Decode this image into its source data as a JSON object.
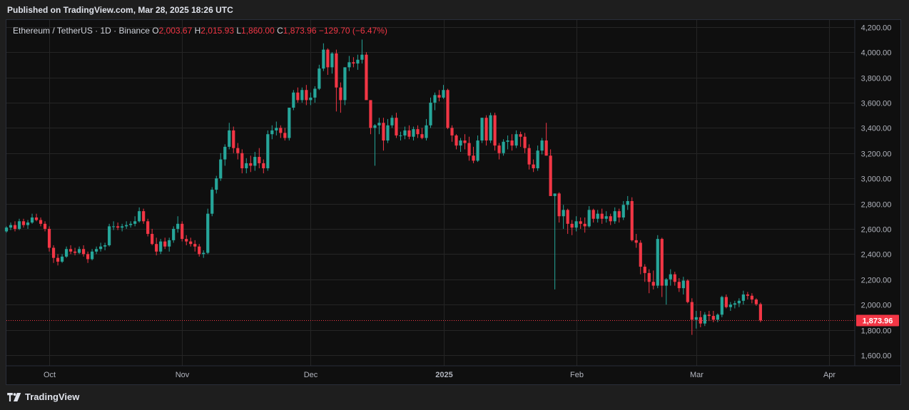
{
  "header": {
    "published": "Published on TradingView.com, Mar 28, 2025 18:26 UTC"
  },
  "legend": {
    "symbol": "Ethereum / TetherUS · 1D · Binance",
    "o_label": "O",
    "o_value": "2,003.67",
    "h_label": "H",
    "h_value": "2,015.93",
    "l_label": "L",
    "l_value": "1,860.00",
    "c_label": "C",
    "c_value": "1,873.96",
    "change": "−129.70 (−6.47%)"
  },
  "footer": {
    "brand": "TradingView",
    "logo_icon": "tradingview-logo-icon"
  },
  "colors": {
    "up": "#26a69a",
    "down": "#f23645",
    "grid": "#252525",
    "price_label_bg": "#f23645",
    "background": "#0f0f0f"
  },
  "chart_data": {
    "type": "candlestick",
    "symbol": "ETHUSDT",
    "interval": "1D",
    "x_axis_type": "date",
    "x_ticks": [
      {
        "label": "Oct",
        "date": "2024-10-01",
        "bold": false
      },
      {
        "label": "Nov",
        "date": "2024-11-01",
        "bold": false
      },
      {
        "label": "Dec",
        "date": "2024-12-01",
        "bold": false
      },
      {
        "label": "2025",
        "date": "2025-01-01",
        "bold": true
      },
      {
        "label": "Feb",
        "date": "2025-02-01",
        "bold": false
      },
      {
        "label": "Mar",
        "date": "2025-03-01",
        "bold": false
      },
      {
        "label": "Apr",
        "date": "2025-04-01",
        "bold": false
      }
    ],
    "x_range": [
      "2024-09-21",
      "2025-04-07"
    ],
    "y_ticks": [
      {
        "value": 1600,
        "label": "1,600.00"
      },
      {
        "value": 1800,
        "label": "1,800.00"
      },
      {
        "value": 2000,
        "label": "2,000.00"
      },
      {
        "value": 2200,
        "label": "2,200.00"
      },
      {
        "value": 2400,
        "label": "2,400.00"
      },
      {
        "value": 2600,
        "label": "2,600.00"
      },
      {
        "value": 2800,
        "label": "2,800.00"
      },
      {
        "value": 3000,
        "label": "3,000.00"
      },
      {
        "value": 3200,
        "label": "3,200.00"
      },
      {
        "value": 3400,
        "label": "3,400.00"
      },
      {
        "value": 3600,
        "label": "3,600.00"
      },
      {
        "value": 3800,
        "label": "3,800.00"
      },
      {
        "value": 4000,
        "label": "4,000.00"
      },
      {
        "value": 4200,
        "label": "4,200.00"
      }
    ],
    "ylim": [
      1515,
      4255
    ],
    "last_price": {
      "value": 1873.96,
      "label": "1,873.96"
    },
    "grid": true,
    "start_date": "2024-09-21",
    "candles": [
      [
        2580,
        2620,
        2570,
        2610
      ],
      [
        2610,
        2650,
        2590,
        2630
      ],
      [
        2630,
        2660,
        2580,
        2600
      ],
      [
        2600,
        2680,
        2590,
        2660
      ],
      [
        2660,
        2680,
        2610,
        2630
      ],
      [
        2630,
        2670,
        2600,
        2650
      ],
      [
        2650,
        2720,
        2640,
        2690
      ],
      [
        2690,
        2720,
        2660,
        2670
      ],
      [
        2670,
        2690,
        2620,
        2640
      ],
      [
        2640,
        2660,
        2580,
        2600
      ],
      [
        2600,
        2620,
        2420,
        2450
      ],
      [
        2450,
        2470,
        2330,
        2370
      ],
      [
        2370,
        2400,
        2310,
        2340
      ],
      [
        2340,
        2400,
        2330,
        2380
      ],
      [
        2380,
        2460,
        2370,
        2440
      ],
      [
        2440,
        2470,
        2400,
        2420
      ],
      [
        2420,
        2450,
        2390,
        2410
      ],
      [
        2410,
        2460,
        2400,
        2440
      ],
      [
        2440,
        2470,
        2380,
        2400
      ],
      [
        2400,
        2420,
        2330,
        2360
      ],
      [
        2360,
        2440,
        2350,
        2420
      ],
      [
        2420,
        2460,
        2400,
        2440
      ],
      [
        2440,
        2490,
        2420,
        2460
      ],
      [
        2460,
        2490,
        2430,
        2470
      ],
      [
        2470,
        2640,
        2460,
        2620
      ],
      [
        2620,
        2660,
        2590,
        2620
      ],
      [
        2620,
        2650,
        2590,
        2610
      ],
      [
        2610,
        2640,
        2580,
        2620
      ],
      [
        2620,
        2660,
        2600,
        2630
      ],
      [
        2630,
        2660,
        2610,
        2640
      ],
      [
        2640,
        2700,
        2620,
        2660
      ],
      [
        2660,
        2770,
        2650,
        2740
      ],
      [
        2740,
        2760,
        2640,
        2660
      ],
      [
        2660,
        2680,
        2540,
        2560
      ],
      [
        2560,
        2600,
        2470,
        2480
      ],
      [
        2480,
        2530,
        2390,
        2420
      ],
      [
        2420,
        2520,
        2400,
        2500
      ],
      [
        2500,
        2530,
        2440,
        2460
      ],
      [
        2460,
        2530,
        2420,
        2510
      ],
      [
        2510,
        2620,
        2490,
        2600
      ],
      [
        2600,
        2700,
        2570,
        2640
      ],
      [
        2640,
        2660,
        2500,
        2520
      ],
      [
        2520,
        2550,
        2470,
        2500
      ],
      [
        2500,
        2530,
        2460,
        2480
      ],
      [
        2480,
        2510,
        2420,
        2460
      ],
      [
        2460,
        2480,
        2380,
        2400
      ],
      [
        2400,
        2430,
        2370,
        2410
      ],
      [
        2410,
        2760,
        2400,
        2720
      ],
      [
        2720,
        2930,
        2700,
        2910
      ],
      [
        2910,
        3020,
        2880,
        3000
      ],
      [
        3000,
        3200,
        2980,
        3150
      ],
      [
        3150,
        3270,
        3100,
        3250
      ],
      [
        3250,
        3440,
        3230,
        3380
      ],
      [
        3380,
        3410,
        3200,
        3240
      ],
      [
        3240,
        3280,
        3150,
        3200
      ],
      [
        3200,
        3230,
        3040,
        3080
      ],
      [
        3080,
        3160,
        3040,
        3120
      ],
      [
        3120,
        3180,
        3050,
        3100
      ],
      [
        3100,
        3210,
        3060,
        3170
      ],
      [
        3170,
        3240,
        3080,
        3120
      ],
      [
        3120,
        3150,
        3040,
        3080
      ],
      [
        3080,
        3380,
        3060,
        3350
      ],
      [
        3350,
        3420,
        3310,
        3380
      ],
      [
        3380,
        3450,
        3340,
        3400
      ],
      [
        3400,
        3420,
        3320,
        3360
      ],
      [
        3360,
        3400,
        3300,
        3320
      ],
      [
        3320,
        3560,
        3300,
        3560
      ],
      [
        3560,
        3700,
        3540,
        3680
      ],
      [
        3680,
        3720,
        3600,
        3620
      ],
      [
        3620,
        3720,
        3600,
        3700
      ],
      [
        3700,
        3740,
        3580,
        3620
      ],
      [
        3620,
        3680,
        3580,
        3640
      ],
      [
        3640,
        3730,
        3600,
        3710
      ],
      [
        3710,
        3900,
        3700,
        3870
      ],
      [
        3870,
        4070,
        3850,
        4020
      ],
      [
        4020,
        4030,
        3820,
        3880
      ],
      [
        3880,
        4000,
        3830,
        3990
      ],
      [
        3990,
        4020,
        3530,
        3720
      ],
      [
        3720,
        3760,
        3520,
        3620
      ],
      [
        3620,
        3880,
        3580,
        3880
      ],
      [
        3880,
        3970,
        3850,
        3920
      ],
      [
        3920,
        3960,
        3880,
        3910
      ],
      [
        3910,
        3980,
        3860,
        3940
      ],
      [
        3940,
        4100,
        3910,
        3980
      ],
      [
        3980,
        4000,
        3650,
        3620
      ],
      [
        3620,
        3620,
        3350,
        3400
      ],
      [
        3400,
        3430,
        3100,
        3420
      ],
      [
        3420,
        3480,
        3350,
        3440
      ],
      [
        3440,
        3480,
        3220,
        3300
      ],
      [
        3300,
        3470,
        3280,
        3420
      ],
      [
        3420,
        3500,
        3400,
        3480
      ],
      [
        3480,
        3520,
        3320,
        3340
      ],
      [
        3340,
        3370,
        3300,
        3340
      ],
      [
        3340,
        3410,
        3310,
        3380
      ],
      [
        3380,
        3420,
        3310,
        3330
      ],
      [
        3330,
        3410,
        3300,
        3390
      ],
      [
        3390,
        3420,
        3320,
        3350
      ],
      [
        3350,
        3400,
        3310,
        3320
      ],
      [
        3320,
        3470,
        3300,
        3420
      ],
      [
        3420,
        3640,
        3400,
        3600
      ],
      [
        3600,
        3680,
        3540,
        3660
      ],
      [
        3660,
        3700,
        3610,
        3640
      ],
      [
        3640,
        3740,
        3630,
        3700
      ],
      [
        3700,
        3710,
        3390,
        3400
      ],
      [
        3400,
        3420,
        3290,
        3340
      ],
      [
        3340,
        3350,
        3230,
        3260
      ],
      [
        3260,
        3320,
        3210,
        3300
      ],
      [
        3300,
        3350,
        3230,
        3280
      ],
      [
        3280,
        3330,
        3140,
        3180
      ],
      [
        3180,
        3250,
        3120,
        3140
      ],
      [
        3140,
        3340,
        3130,
        3300
      ],
      [
        3300,
        3480,
        3280,
        3480
      ],
      [
        3480,
        3500,
        3260,
        3300
      ],
      [
        3300,
        3520,
        3280,
        3500
      ],
      [
        3500,
        3520,
        3220,
        3260
      ],
      [
        3260,
        3280,
        3150,
        3200
      ],
      [
        3200,
        3310,
        3180,
        3290
      ],
      [
        3290,
        3340,
        3230,
        3300
      ],
      [
        3300,
        3350,
        3220,
        3260
      ],
      [
        3260,
        3380,
        3240,
        3350
      ],
      [
        3350,
        3370,
        3250,
        3330
      ],
      [
        3330,
        3360,
        3200,
        3240
      ],
      [
        3240,
        3270,
        3070,
        3110
      ],
      [
        3110,
        3150,
        3050,
        3080
      ],
      [
        3080,
        3260,
        3060,
        3220
      ],
      [
        3220,
        3320,
        3190,
        3300
      ],
      [
        3300,
        3440,
        3180,
        3180
      ],
      [
        3180,
        3230,
        2950,
        2860
      ],
      [
        2860,
        2880,
        2120,
        2880
      ],
      [
        2880,
        2890,
        2650,
        2700
      ],
      [
        2700,
        2790,
        2600,
        2750
      ],
      [
        2750,
        2760,
        2560,
        2640
      ],
      [
        2640,
        2670,
        2550,
        2610
      ],
      [
        2610,
        2700,
        2580,
        2660
      ],
      [
        2660,
        2690,
        2600,
        2640
      ],
      [
        2640,
        2690,
        2570,
        2620
      ],
      [
        2620,
        2780,
        2610,
        2750
      ],
      [
        2750,
        2760,
        2650,
        2680
      ],
      [
        2680,
        2750,
        2650,
        2720
      ],
      [
        2720,
        2760,
        2640,
        2680
      ],
      [
        2680,
        2740,
        2650,
        2700
      ],
      [
        2700,
        2720,
        2630,
        2660
      ],
      [
        2660,
        2770,
        2640,
        2740
      ],
      [
        2740,
        2760,
        2650,
        2690
      ],
      [
        2690,
        2820,
        2670,
        2790
      ],
      [
        2790,
        2860,
        2750,
        2820
      ],
      [
        2820,
        2850,
        2500,
        2510
      ],
      [
        2510,
        2560,
        2450,
        2490
      ],
      [
        2490,
        2510,
        2240,
        2300
      ],
      [
        2300,
        2320,
        2180,
        2250
      ],
      [
        2250,
        2280,
        2090,
        2180
      ],
      [
        2180,
        2270,
        2120,
        2150
      ],
      [
        2150,
        2550,
        2130,
        2520
      ],
      [
        2520,
        2530,
        2060,
        2150
      ],
      [
        2150,
        2210,
        2000,
        2200
      ],
      [
        2200,
        2280,
        2150,
        2240
      ],
      [
        2240,
        2260,
        2150,
        2180
      ],
      [
        2180,
        2210,
        2100,
        2130
      ],
      [
        2130,
        2220,
        2080,
        2190
      ],
      [
        2190,
        2200,
        2010,
        2020
      ],
      [
        2020,
        2050,
        1760,
        1880
      ],
      [
        1880,
        1950,
        1810,
        1900
      ],
      [
        1900,
        1950,
        1820,
        1850
      ],
      [
        1850,
        1940,
        1830,
        1920
      ],
      [
        1920,
        1950,
        1870,
        1910
      ],
      [
        1910,
        1950,
        1860,
        1880
      ],
      [
        1880,
        1930,
        1860,
        1920
      ],
      [
        1920,
        2070,
        1900,
        2060
      ],
      [
        2060,
        2080,
        1970,
        1980
      ],
      [
        1980,
        2020,
        1950,
        2000
      ],
      [
        2000,
        2030,
        1970,
        2010
      ],
      [
        2010,
        2050,
        1980,
        2030
      ],
      [
        2030,
        2110,
        2000,
        2080
      ],
      [
        2080,
        2100,
        2040,
        2070
      ],
      [
        2070,
        2090,
        2010,
        2040
      ],
      [
        2040,
        2050,
        1990,
        2003
      ],
      [
        2003.67,
        2015.93,
        1860.0,
        1873.96
      ]
    ]
  }
}
